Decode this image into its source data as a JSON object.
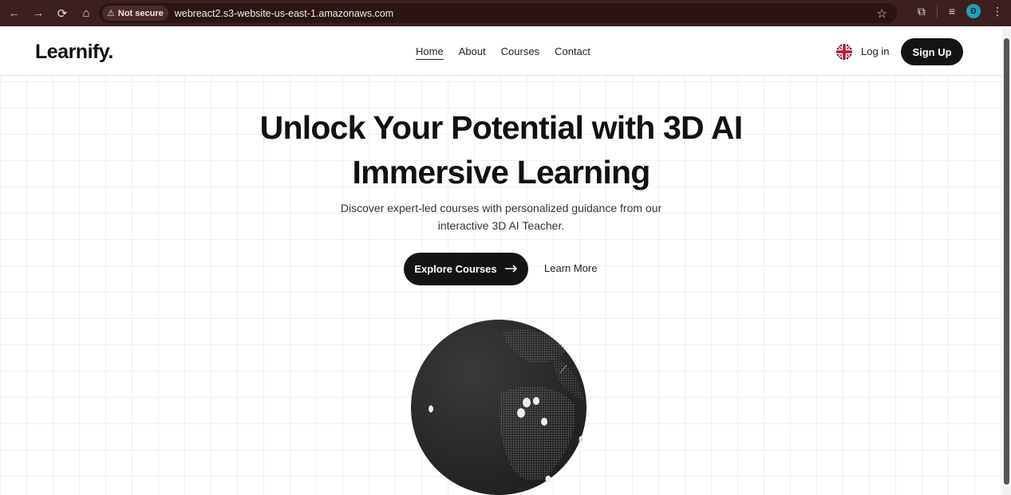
{
  "browser": {
    "security_label": "Not secure",
    "url": "webreact2.s3-website-us-east-1.amazonaws.com",
    "profile_initial": "Đ"
  },
  "header": {
    "logo": "Learnify.",
    "nav": [
      "Home",
      "About",
      "Courses",
      "Contact"
    ],
    "login_label": "Log in",
    "signup_label": "Sign Up"
  },
  "hero": {
    "title_line1": "Unlock Your Potential with 3D AI",
    "title_line2": "Immersive Learning",
    "subtitle_line1": "Discover expert-led courses with personalized guidance from our",
    "subtitle_line2": "interactive 3D AI Teacher.",
    "primary_button": "Explore Courses",
    "primary_button_icon": "arrow-right-icon",
    "secondary_button": "Learn More"
  },
  "colors": {
    "chrome_bg": "#3c1f1f",
    "primary_button_bg": "#141414",
    "globe": "#2b2b2b"
  }
}
